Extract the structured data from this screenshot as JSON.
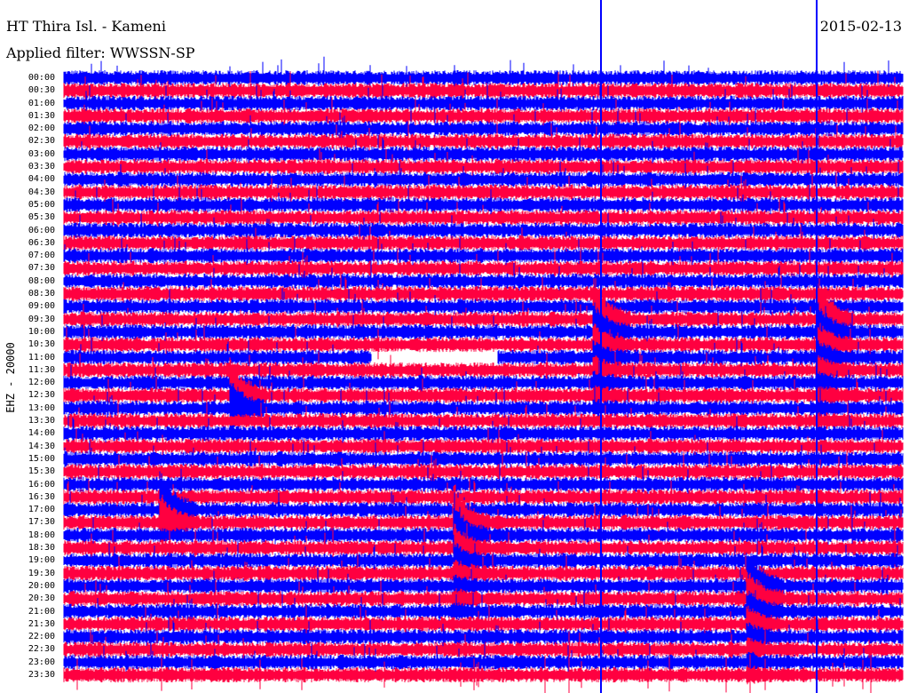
{
  "header": {
    "station": "HT Thira Isl. - Kameni",
    "filter": "Applied filter: WWSSN-SP",
    "date": "2015-02-13"
  },
  "chart_data": {
    "type": "line",
    "title": "HT Thira Isl. - Kameni",
    "ylabel": "EHZ - 20000",
    "row_labels": [
      "00:00",
      "00:30",
      "01:00",
      "01:30",
      "02:00",
      "02:30",
      "03:00",
      "03:30",
      "04:00",
      "04:30",
      "05:00",
      "05:30",
      "06:00",
      "06:30",
      "07:00",
      "07:30",
      "08:00",
      "08:30",
      "09:00",
      "09:30",
      "10:00",
      "10:30",
      "11:00",
      "11:30",
      "12:00",
      "12:30",
      "13:00",
      "13:30",
      "14:00",
      "14:30",
      "15:00",
      "15:30",
      "16:00",
      "16:30",
      "17:00",
      "17:30",
      "18:00",
      "18:30",
      "19:00",
      "19:30",
      "20:00",
      "20:30",
      "21:00",
      "21:30",
      "22:00",
      "22:30",
      "23:00",
      "23:30"
    ],
    "minutes_per_row": 30,
    "series_colors": [
      "#0000ff",
      "#ff0040"
    ],
    "events": [
      {
        "row": "09:30",
        "minute": 19,
        "rows_affected": 8
      },
      {
        "row": "09:30",
        "minute": 27,
        "rows_affected": 9
      },
      {
        "row": "17:30",
        "minute": 14,
        "rows_affected": 8
      },
      {
        "row": "20:00",
        "minute": 24.5,
        "rows_affected": 8
      },
      {
        "row": "12:30",
        "minute": 6,
        "rows_affected": 2
      },
      {
        "row": "17:00",
        "minute": 3.5,
        "rows_affected": 2
      }
    ],
    "gap": {
      "row": "11:00",
      "start_minute": 11,
      "end_minute": 15.5
    }
  }
}
